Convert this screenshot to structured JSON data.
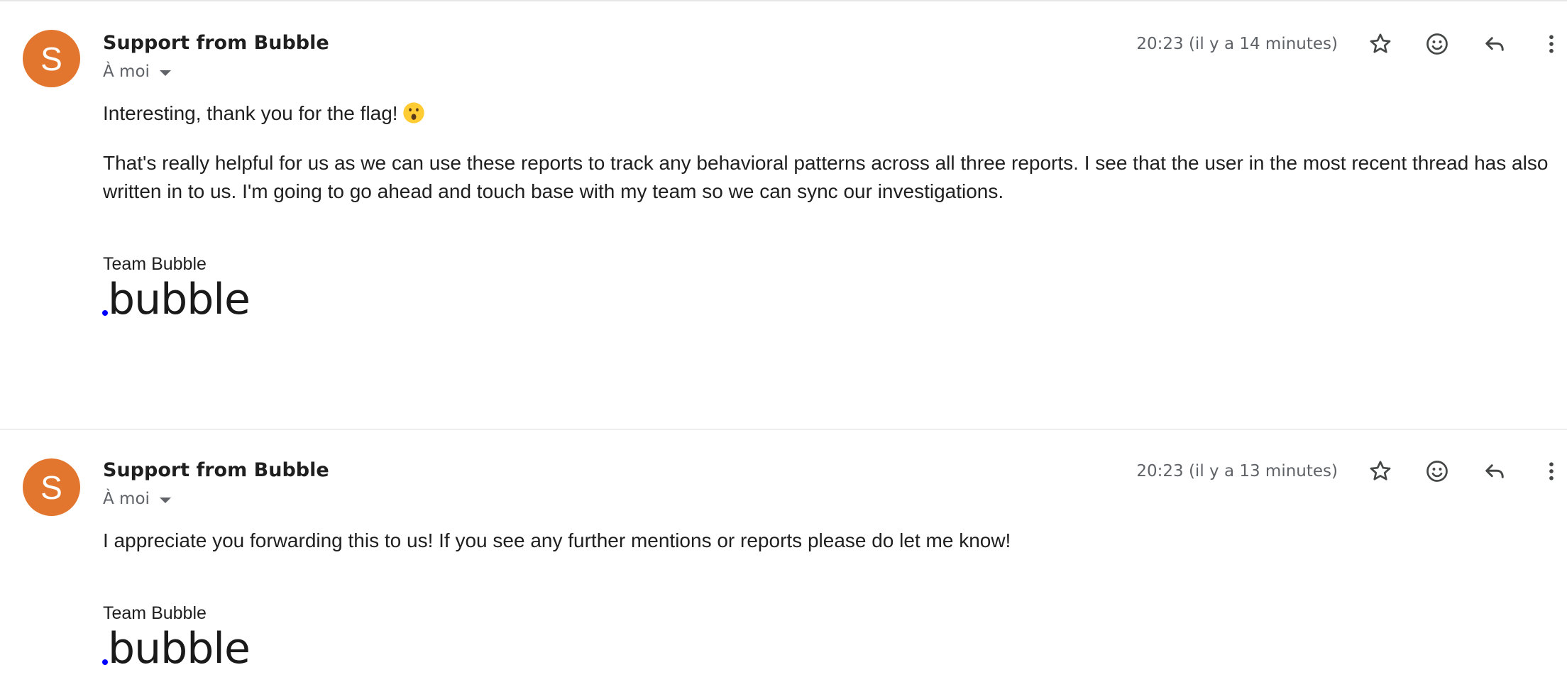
{
  "messages": [
    {
      "avatar_letter": "S",
      "sender": "Support from Bubble",
      "recipient": "À moi",
      "timestamp": "20:23 (il y a 14 minutes)",
      "paragraphs": [
        "Interesting, thank you for the flag!",
        "That's really helpful for us as we can use these reports to track any behavioral patterns across all three reports. I see that the user in the most recent thread has also written in to us. I'm going to go ahead and touch base with my team so we can sync our investigations."
      ],
      "signature": "Team Bubble",
      "logo_text": "bubble"
    },
    {
      "avatar_letter": "S",
      "sender": "Support from Bubble",
      "recipient": "À moi",
      "timestamp": "20:23 (il y a 13 minutes)",
      "paragraphs": [
        "I appreciate you forwarding this to us! If you see any further mentions or reports please do let me know!"
      ],
      "signature": "Team Bubble",
      "logo_text": "bubble"
    }
  ],
  "icons": {
    "star": "star-icon",
    "emoji": "emoji-reaction-icon",
    "reply": "reply-icon",
    "more": "more-vert-icon",
    "astonished": "astonished-face-emoji"
  },
  "colors": {
    "avatar": "#e2762e",
    "logo_dot": "#0000ff"
  }
}
